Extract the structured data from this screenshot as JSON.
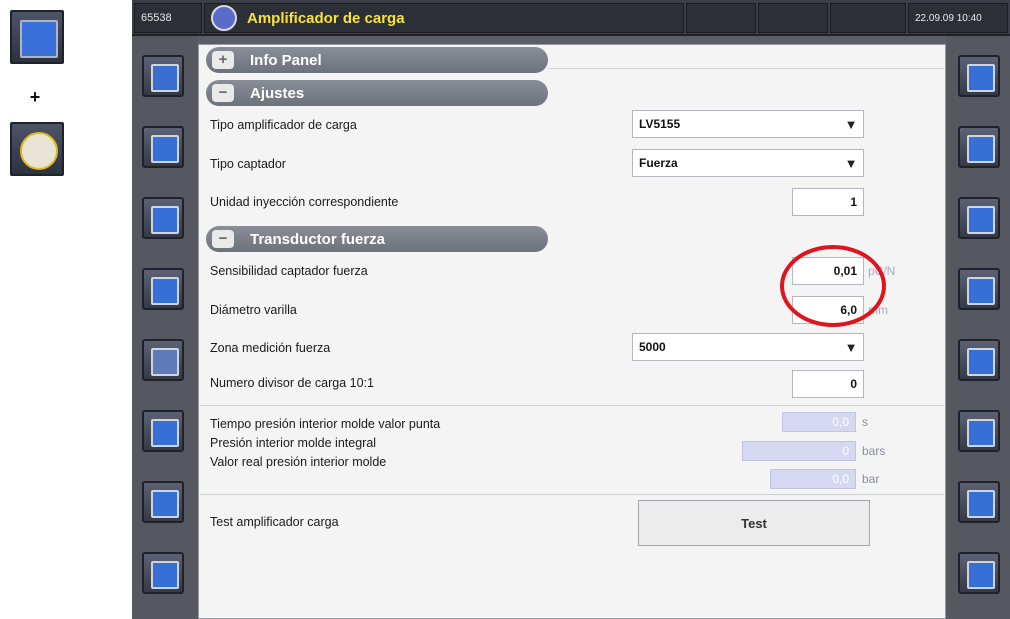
{
  "header": {
    "machine_number": "65538",
    "title": "Amplificador de carga",
    "datetime": "22.09.09 10:40"
  },
  "legend": {
    "plus": "+"
  },
  "sections": {
    "info_panel": {
      "toggle": "+",
      "label": "Info Panel"
    },
    "ajustes": {
      "toggle": "−",
      "label": "Ajustes"
    },
    "transductor": {
      "toggle": "−",
      "label": "Transductor fuerza"
    }
  },
  "ajustes": {
    "tipo_amplificador": {
      "label": "Tipo amplificador de carga",
      "value": "LV5155"
    },
    "tipo_captador": {
      "label": "Tipo captador",
      "value": "Fuerza"
    },
    "unidad_inyeccion": {
      "label": "Unidad inyección correspondiente",
      "value": "1"
    }
  },
  "transductor": {
    "sensibilidad": {
      "label": "Sensibilidad captador fuerza",
      "value": "0,01",
      "unit": "pC/N"
    },
    "diametro": {
      "label": "Diámetro varilla",
      "value": "6,0",
      "unit": "mm"
    },
    "zona_medicion": {
      "label": "Zona medición fuerza",
      "value": "5000"
    },
    "numero_divisor": {
      "label": "Numero divisor de carga 10:1",
      "value": "0"
    }
  },
  "readouts": {
    "tiempo_presion": {
      "label": "Tiempo presión interior molde valor punta",
      "value": "0,0",
      "unit": "s"
    },
    "presion_integral": {
      "label": "Presión interior molde integral",
      "value": "0",
      "unit": "bars"
    },
    "valor_real": {
      "label": "Valor real presión interior molde",
      "value": "0,0",
      "unit": "bar"
    }
  },
  "test": {
    "label": "Test amplificador carga",
    "button": "Test"
  },
  "icons": {
    "left": [
      "mold-icon",
      "transfer-icon",
      "transfer-icon",
      "nozzle-icon",
      "xray-icon",
      "hand-icon",
      "mold-transfer-icon",
      "hand-transfer-icon"
    ],
    "right": [
      "rotate-icon",
      "camera-icon",
      "copy-icon",
      "sequence-icon",
      "print-icon",
      "edit-icon",
      "edit-icon",
      "edit-icon"
    ]
  },
  "colors": {
    "title_text": "#f6e33a",
    "highlight_circle": "#e0141c",
    "readonly_field": "#d6d8f2"
  }
}
